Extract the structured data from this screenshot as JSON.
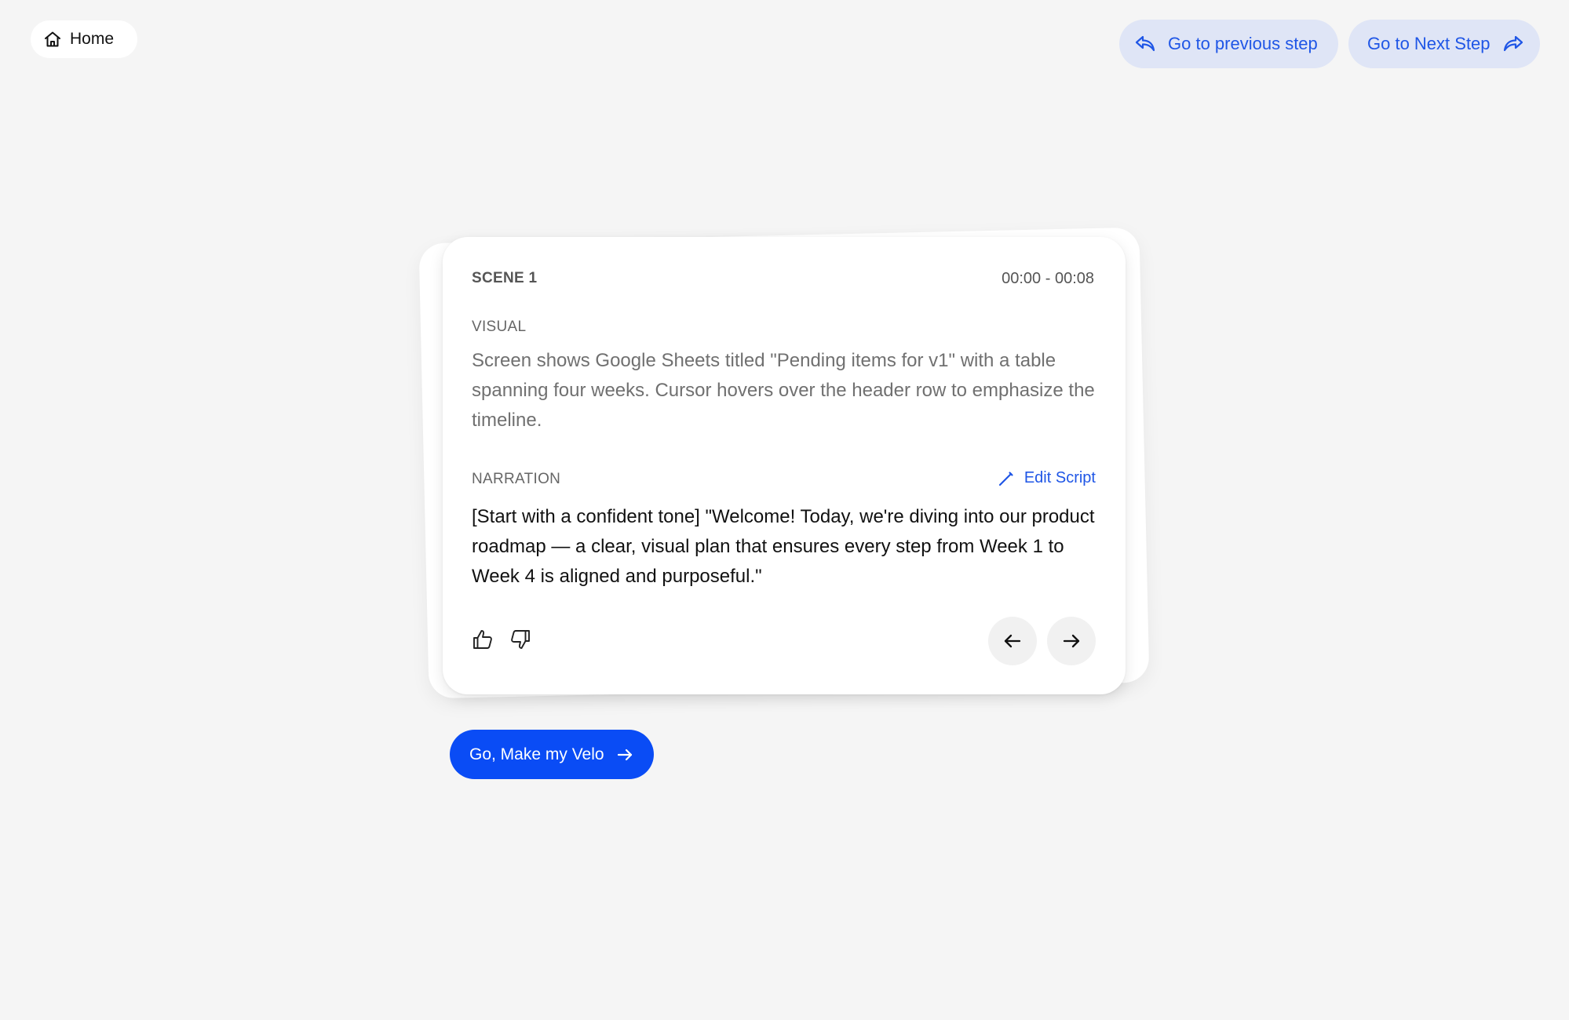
{
  "header": {
    "home_label": "Home",
    "prev_step_label": "Go to previous step",
    "next_step_label": "Go to Next Step"
  },
  "scene": {
    "label": "SCENE 1",
    "time_range": "00:00 - 00:08",
    "visual_label": "VISUAL",
    "visual_text": "Screen shows Google Sheets titled \"Pending items for v1\" with a table spanning four weeks. Cursor hovers over the header row to emphasize the timeline.",
    "narration_label": "NARRATION",
    "edit_script_label": "Edit Script",
    "narration_text": "[Start with a confident tone] \"Welcome! Today, we're diving into our product roadmap — a clear, visual plan that ensures every step from Week 1 to Week 4 is aligned and purposeful.\""
  },
  "cta": {
    "label": "Go, Make my Velo"
  },
  "icons": {
    "home": "home-icon",
    "prev_step": "reply-arrow-icon",
    "next_step": "share-arrow-icon",
    "edit": "pencil-icon",
    "thumbs_up": "thumbs-up-icon",
    "thumbs_down": "thumbs-down-icon",
    "arrow_left": "arrow-left-icon",
    "arrow_right": "arrow-right-icon"
  },
  "colors": {
    "background": "#f5f5f5",
    "accent": "#0a4cf5",
    "link": "#1f56e6",
    "step_button_bg": "#dfe5f6"
  }
}
